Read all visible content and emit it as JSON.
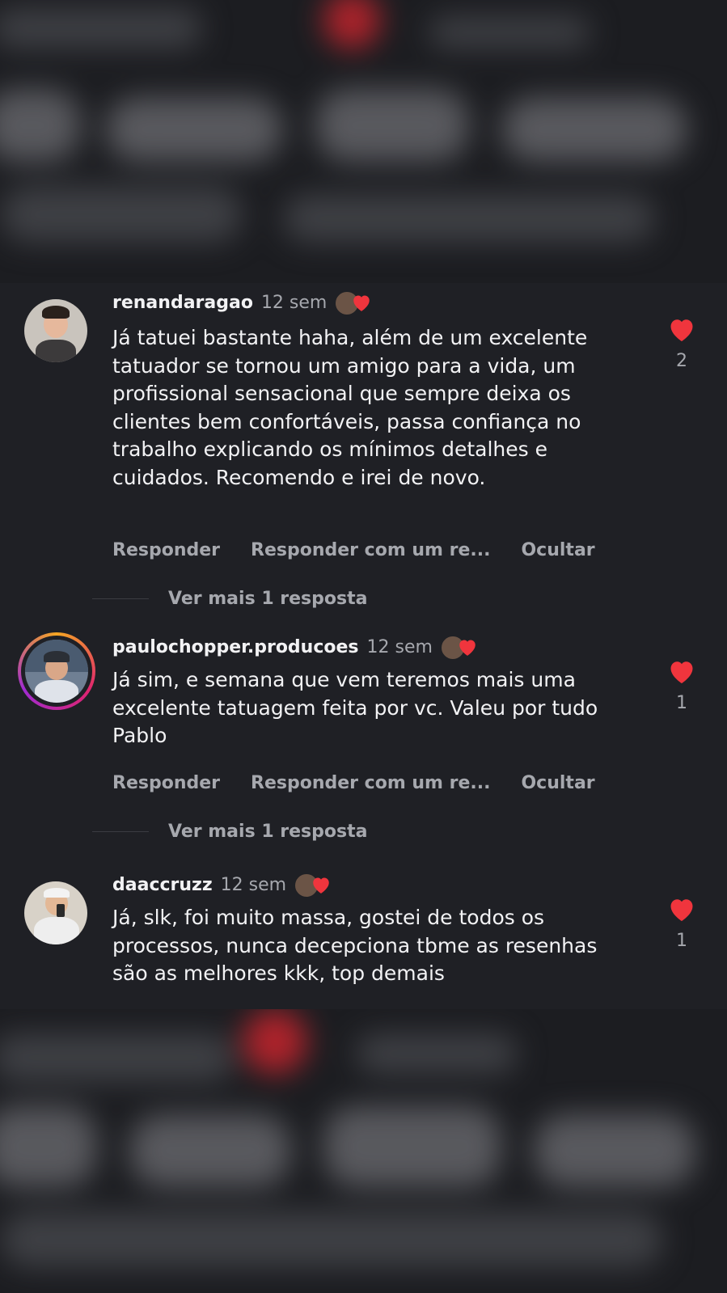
{
  "comments": [
    {
      "username": "renandaragao",
      "time": "12 sem",
      "text": "Já tatuei bastante haha, além de um excelente tatuador se tornou um amigo para a vida, um profissional sensacional que sempre deixa os clientes bem confortáveis, passa confiança no trabalho explicando os mínimos detalhes e cuidados. Recomendo e irei de novo.",
      "likes": "2",
      "actions": {
        "reply": "Responder",
        "reply_with": "Responder com um re...",
        "hide": "Ocultar"
      },
      "replies": "Ver mais 1 resposta"
    },
    {
      "username": "paulochopper.producoes",
      "time": "12 sem",
      "text": "Já sim, e semana que vem teremos mais uma excelente tatuagem feita por vc. Valeu por tudo Pablo",
      "likes": "1",
      "actions": {
        "reply": "Responder",
        "reply_with": "Responder com um re...",
        "hide": "Ocultar"
      },
      "replies": "Ver mais 1 resposta"
    },
    {
      "username": "daaccruzz",
      "time": "12 sem",
      "text": "Já, slk, foi muito massa, gostei de todos os processos, nunca decepciona tbme as resenhas são as melhores kkk, top demais",
      "likes": "1"
    }
  ],
  "colors": {
    "heart": "#f0353d",
    "background": "#1f2025",
    "muted_text": "#a6a8ae"
  },
  "icons": {
    "like": "heart-icon",
    "author_liked": "creator-liked-heart-icon"
  }
}
